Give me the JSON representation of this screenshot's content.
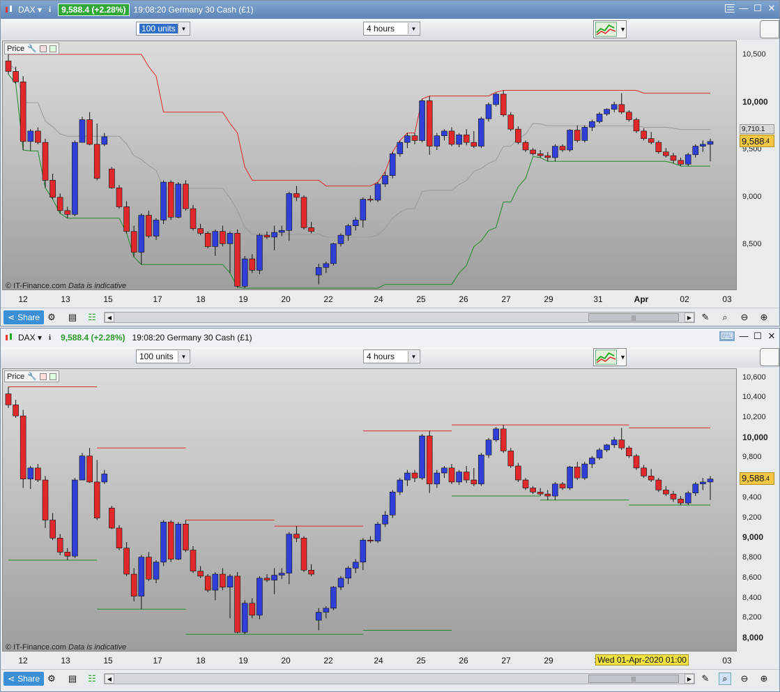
{
  "colors": {
    "bull": "#2f3fd8",
    "bear": "#e1282b",
    "upper": "#e1282b",
    "lower": "#1f8a2a",
    "mid": "#9a9a9a",
    "cursor": "#f4c842"
  },
  "w1": {
    "ticker": "DAX",
    "info": "i",
    "price_change": "9,588.4 (+2.28%)",
    "title": "19:08:20 Germany 30 Cash (£1)",
    "units": "100 units",
    "timeframe": "4 hours",
    "price_label": "Price",
    "copyright": "© IT-Finance.com",
    "disclaimer": "Data is indicative",
    "y_ticks": [
      "10,500",
      "10,000",
      "9,500",
      "9,000",
      "8,500"
    ],
    "y_tick_values": [
      10500,
      10000,
      9500,
      9000,
      8500
    ],
    "y_bold": [
      false,
      true,
      false,
      false,
      false
    ],
    "gray_tag": "9,710.1",
    "current_main": "9,588",
    "current_sup": ".4",
    "x_labels": [
      "12",
      "13",
      "15",
      "17",
      "18",
      "19",
      "20",
      "22",
      "24",
      "25",
      "26",
      "27",
      "29",
      "31",
      "Apr",
      "02",
      "03"
    ],
    "share": "Share"
  },
  "w2": {
    "ticker": "DAX",
    "info": "i",
    "price_change": "9,588.4 (+2.28%)",
    "title": "19:08:20 Germany 30 Cash (£1)",
    "units": "100 units",
    "timeframe": "4 hours",
    "price_label": "Price",
    "copyright": "© IT-Finance.com",
    "disclaimer": "Data is indicative",
    "y_ticks": [
      "10,600",
      "10,400",
      "10,200",
      "10,000",
      "9,800",
      "9,600",
      "9,400",
      "9,200",
      "9,000",
      "8,800",
      "8,600",
      "8,400",
      "8,200",
      "8,000"
    ],
    "y_tick_values": [
      10600,
      10400,
      10200,
      10000,
      9800,
      9600,
      9400,
      9200,
      9000,
      8800,
      8600,
      8400,
      8200,
      8000
    ],
    "y_bold": [
      false,
      false,
      false,
      true,
      false,
      false,
      false,
      false,
      true,
      false,
      false,
      false,
      false,
      true
    ],
    "current_main": "9,588",
    "current_sup": ".4",
    "x_labels": [
      "12",
      "13",
      "15",
      "17",
      "18",
      "19",
      "20",
      "22",
      "24",
      "25",
      "26",
      "27",
      "29",
      "3",
      "02",
      "03"
    ],
    "cursor_date": "Wed 01-Apr-2020 01:00",
    "share": "Share"
  },
  "chart_data": [
    {
      "type": "candlestick",
      "title": "Germany 30 Cash (£1)",
      "timeframe": "4 hours",
      "ylim": [
        8050,
        10650
      ],
      "candles_ohlc": [
        [
          10440,
          10510,
          10300,
          10330
        ],
        [
          10330,
          10380,
          10200,
          10220
        ],
        [
          10220,
          10280,
          9500,
          9590
        ],
        [
          9590,
          9720,
          9490,
          9700
        ],
        [
          9700,
          9740,
          9560,
          9580
        ],
        [
          9580,
          9620,
          9100,
          9180
        ],
        [
          9180,
          9250,
          8980,
          9000
        ],
        [
          9000,
          9040,
          8830,
          8860
        ],
        [
          8860,
          8900,
          8780,
          8820
        ],
        [
          8820,
          9600,
          8800,
          9580
        ],
        [
          9580,
          9850,
          9580,
          9820
        ],
        [
          9820,
          9900,
          9550,
          9560
        ],
        [
          9560,
          9780,
          9180,
          9200
        ],
        [
          9560,
          9680,
          9540,
          9640
        ],
        [
          9300,
          9320,
          9090,
          9100
        ],
        [
          9100,
          9130,
          8880,
          8900
        ],
        [
          8900,
          8960,
          8620,
          8640
        ],
        [
          8640,
          8700,
          8370,
          8420
        ],
        [
          8420,
          8830,
          8290,
          8810
        ],
        [
          8810,
          8860,
          8570,
          8590
        ],
        [
          8590,
          8780,
          8550,
          8760
        ],
        [
          8760,
          9180,
          8720,
          9160
        ],
        [
          9160,
          9180,
          8760,
          8790
        ],
        [
          8790,
          9160,
          8780,
          9140
        ],
        [
          9140,
          9180,
          8860,
          8880
        ],
        [
          8880,
          8920,
          8650,
          8670
        ],
        [
          8670,
          8720,
          8600,
          8620
        ],
        [
          8620,
          8640,
          8460,
          8480
        ],
        [
          8480,
          8660,
          8380,
          8640
        ],
        [
          8640,
          8700,
          8480,
          8510
        ],
        [
          8510,
          8640,
          8200,
          8620
        ],
        [
          8620,
          8660,
          8050,
          8060
        ],
        [
          8060,
          8380,
          8040,
          8350
        ],
        [
          8350,
          8400,
          8200,
          8230
        ],
        [
          8230,
          8620,
          8190,
          8600
        ],
        [
          8600,
          8640,
          8560,
          8580
        ],
        [
          8580,
          8700,
          8440,
          8630
        ],
        [
          8630,
          8700,
          8590,
          8650
        ],
        [
          8650,
          9060,
          8540,
          9040
        ],
        [
          9040,
          9120,
          8960,
          9000
        ],
        [
          9000,
          9020,
          8660,
          8680
        ],
        [
          8680,
          8740,
          8620,
          8640
        ],
        [
          8180,
          8300,
          8080,
          8260
        ],
        [
          8260,
          8320,
          8200,
          8300
        ],
        [
          8300,
          8520,
          8280,
          8510
        ],
        [
          8510,
          8620,
          8480,
          8600
        ],
        [
          8600,
          8720,
          8540,
          8700
        ],
        [
          8700,
          8790,
          8650,
          8760
        ],
        [
          8760,
          9000,
          8680,
          8980
        ],
        [
          8980,
          9020,
          8950,
          8970
        ],
        [
          8970,
          9160,
          8950,
          9140
        ],
        [
          9140,
          9270,
          9110,
          9230
        ],
        [
          9230,
          9480,
          9200,
          9460
        ],
        [
          9460,
          9600,
          9430,
          9580
        ],
        [
          9580,
          9680,
          9520,
          9650
        ],
        [
          9650,
          9680,
          9560,
          9600
        ],
        [
          9600,
          10040,
          9580,
          10020
        ],
        [
          10020,
          10070,
          9450,
          9540
        ],
        [
          9540,
          9680,
          9500,
          9650
        ],
        [
          9650,
          9720,
          9600,
          9700
        ],
        [
          9700,
          9740,
          9540,
          9560
        ],
        [
          9560,
          9680,
          9530,
          9660
        ],
        [
          9660,
          9720,
          9550,
          9580
        ],
        [
          9580,
          9700,
          9520,
          9540
        ],
        [
          9540,
          9850,
          9520,
          9830
        ],
        [
          9830,
          10000,
          9800,
          9980
        ],
        [
          9980,
          10110,
          9960,
          10090
        ],
        [
          10090,
          10130,
          9850,
          9870
        ],
        [
          9870,
          9900,
          9700,
          9720
        ],
        [
          9720,
          9750,
          9560,
          9580
        ],
        [
          9580,
          9600,
          9480,
          9500
        ],
        [
          9500,
          9520,
          9440,
          9460
        ],
        [
          9460,
          9500,
          9420,
          9440
        ],
        [
          9440,
          9480,
          9380,
          9420
        ],
        [
          9420,
          9560,
          9380,
          9540
        ],
        [
          9540,
          9560,
          9480,
          9500
        ],
        [
          9500,
          9720,
          9480,
          9710
        ],
        [
          9710,
          9760,
          9580,
          9600
        ],
        [
          9600,
          9760,
          9580,
          9740
        ],
        [
          9740,
          9820,
          9700,
          9800
        ],
        [
          9800,
          9900,
          9780,
          9880
        ],
        [
          9880,
          9940,
          9860,
          9930
        ],
        [
          9930,
          10010,
          9900,
          9980
        ],
        [
          9980,
          10100,
          9880,
          9900
        ],
        [
          9900,
          9920,
          9800,
          9820
        ],
        [
          9820,
          9840,
          9680,
          9700
        ],
        [
          9700,
          9730,
          9600,
          9620
        ],
        [
          9620,
          9690,
          9560,
          9580
        ],
        [
          9580,
          9600,
          9460,
          9480
        ],
        [
          9480,
          9520,
          9420,
          9440
        ],
        [
          9440,
          9470,
          9360,
          9390
        ],
        [
          9390,
          9420,
          9330,
          9350
        ],
        [
          9350,
          9470,
          9330,
          9450
        ],
        [
          9450,
          9560,
          9420,
          9540
        ],
        [
          9540,
          9600,
          9480,
          9560
        ],
        [
          9560,
          9620,
          9380,
          9590
        ]
      ]
    }
  ]
}
